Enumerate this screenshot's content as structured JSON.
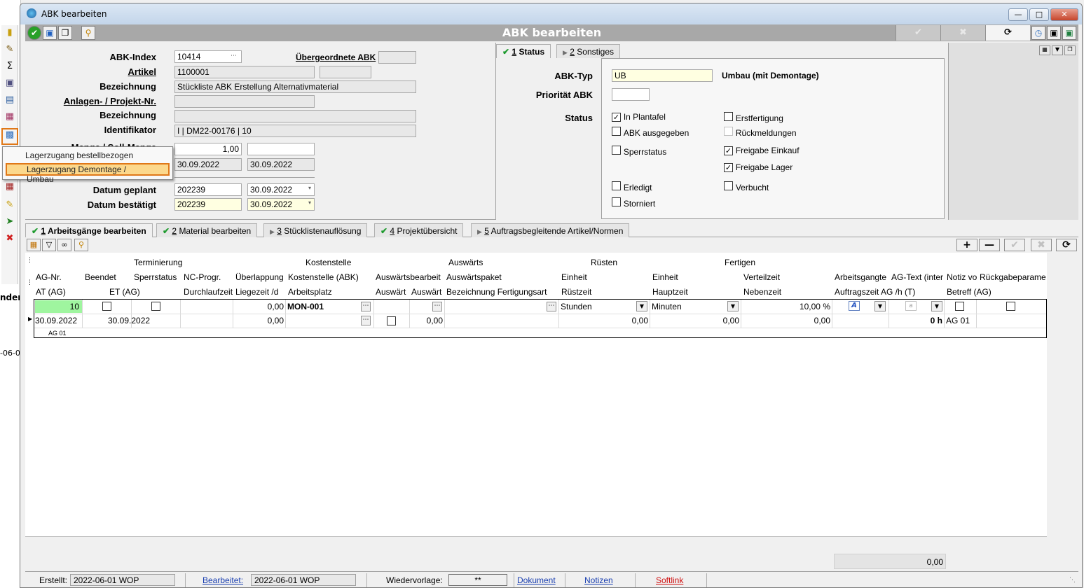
{
  "window": {
    "title": "ABK bearbeiten"
  },
  "header": {
    "title": "ABK bearbeiten",
    "confirm_icon": "check-icon",
    "cancel_icon": "x-icon",
    "refresh_icon": "refresh-icon"
  },
  "background": {
    "frag1": "nden",
    "frag2": "-06-0"
  },
  "popup": {
    "item1": "Lagerzugang bestellbezogen",
    "item2": "Lagerzugang Demontage / Umbau"
  },
  "form": {
    "abk_index_label": "ABK-Index",
    "abk_index_value": "10414",
    "parent_abk_label": "Übergeordnete ABK",
    "artikel_label": "Artikel",
    "artikel_value": "1100001",
    "bezeichnung_label": "Bezeichnung",
    "bezeichnung_value": "Stückliste ABK Erstellung Alternativmaterial",
    "anlagen_label": "Anlagen- / Projekt-Nr.",
    "bezeichnung2_label": "Bezeichnung",
    "identifikator_label": "Identifikator",
    "identifikator_value": "I | DM22-00176 | 10",
    "menge_label": "Menge / Soll-Menge",
    "menge_value": "1,00",
    "datum1_a": "30.09.2022",
    "datum1_b": "30.09.2022",
    "datum_geplant_label": "Datum geplant",
    "datum_geplant_week": "202239",
    "datum_geplant_date": "30.09.2022",
    "datum_bestaetigt_label": "Datum bestätigt",
    "datum_bestaetigt_week": "202239",
    "datum_bestaetigt_date": "30.09.2022"
  },
  "status_tabs": [
    {
      "num": "1",
      "label": "Status"
    },
    {
      "num": "2",
      "label": "Sonstiges"
    }
  ],
  "status": {
    "abk_typ_label": "ABK-Typ",
    "abk_typ_value": "UB",
    "abk_typ_desc": "Umbau (mit Demontage)",
    "prioritaet_label": "Priorität ABK",
    "status_label": "Status",
    "cb": {
      "in_plantafel": "In Plantafel",
      "erstfertigung": "Erstfertigung",
      "abk_ausgegeben": "ABK ausgegeben",
      "rueckmeldungen": "Rückmeldungen",
      "sperrstatus": "Sperrstatus",
      "freigabe_einkauf": "Freigabe Einkauf",
      "freigabe_lager": "Freigabe Lager",
      "erledigt": "Erledigt",
      "verbucht": "Verbucht",
      "storniert": "Storniert"
    }
  },
  "bottom_tabs": [
    {
      "num": "1",
      "label": "Arbeitsgänge bearbeiten"
    },
    {
      "num": "2",
      "label": "Material bearbeiten"
    },
    {
      "num": "3",
      "label": "Stücklistenauflösung"
    },
    {
      "num": "4",
      "label": "Projektübersicht"
    },
    {
      "num": "5",
      "label": "Auftragsbegleitende Artikel/Normen"
    }
  ],
  "grid": {
    "groups": {
      "terminierung": "Terminierung",
      "kostenstelle": "Kostenstelle",
      "auswaerts": "Auswärts",
      "ruesten": "Rüsten",
      "fertigen": "Fertigen"
    },
    "h1": [
      "AG-Nr.",
      "Beendet",
      "Sperrstatus",
      "NC-Progr.",
      "Überlappung",
      "Kostenstelle (ABK)",
      "Auswärtsbearbeit",
      "Auswärtspaket",
      "Einheit",
      "Einheit",
      "Verteilzeit",
      "Arbeitsgangte",
      "AG-Text (inter",
      "Notiz vo",
      "Rückgabeparame"
    ],
    "h2": [
      "AT (AG)",
      "ET (AG)",
      "Durchlaufzeit",
      "Liegezeit /d",
      "Arbeitsplatz",
      "Auswärt",
      "Auswärt",
      "Bezeichnung Fertigungsart",
      "Rüstzeit",
      "Hauptzeit",
      "Nebenzeit",
      "Auftragszeit",
      "AG /h (T)",
      "Betreff (AG)"
    ],
    "row1": {
      "ag_nr": "10",
      "ueberlappung": "0,00",
      "kostenstelle": "MON-001",
      "ruesten_einheit": "Stunden",
      "fertigen_einheit": "Minuten",
      "verteilzeit": "10,00 %"
    },
    "row2": {
      "at": "30.09.2022",
      "et": "30.09.2022",
      "liegezeit": "0,00",
      "auswaert": "0,00",
      "ruestzeit": "0,00",
      "hauptzeit": "0,00",
      "nebenzeit": "0,00",
      "auftragszeit": "0 h",
      "betreff": "AG 01"
    },
    "row3": {
      "note": "AG 01"
    },
    "sum": "0,00"
  },
  "statusbar": {
    "erstellt_label": "Erstellt:",
    "erstellt_value": "2022-06-01  WOP",
    "bearbeitet_label": "Bearbeitet:",
    "bearbeitet_value": "2022-06-01  WOP",
    "wiedervorlage_label": "Wiedervorlage:",
    "wiedervorlage_value": "**",
    "dokument": "Dokument",
    "notizen": "Notizen",
    "softlink": "Softlink"
  },
  "colors": {
    "accent_orange": "#e07818",
    "header_gray": "#a8a8a8",
    "yellow_field": "#ffffe1",
    "green_cell": "#9ff59f"
  }
}
